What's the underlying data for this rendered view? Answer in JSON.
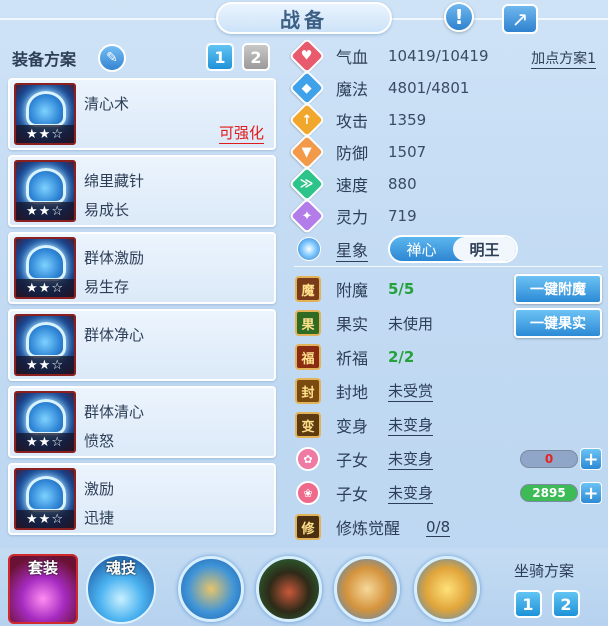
{
  "title": "战备",
  "header": {
    "info_icon": "!",
    "share_icon": "↗"
  },
  "equip_scheme": {
    "label": "装备方案",
    "buttons": [
      "1",
      "2"
    ],
    "active": "1"
  },
  "equipment": [
    {
      "name": "清心术",
      "sub": "",
      "action": "可强化",
      "stars": "★★☆"
    },
    {
      "name": "绵里藏针",
      "sub": "易成长",
      "action": "",
      "stars": "★★☆"
    },
    {
      "name": "群体激励",
      "sub": "易生存",
      "action": "",
      "stars": "★★☆"
    },
    {
      "name": "群体净心",
      "sub": "",
      "action": "",
      "stars": "★★☆"
    },
    {
      "name": "群体清心",
      "sub": "愤怒",
      "action": "",
      "stars": "★★☆"
    },
    {
      "name": "激励",
      "sub": "迅捷",
      "action": "",
      "stars": "★★☆"
    }
  ],
  "stats": [
    {
      "label": "气血",
      "value": "10419/10419",
      "color": "#e85a6e",
      "icon": "heart-icon",
      "glyph": "♥"
    },
    {
      "label": "魔法",
      "value": "4801/4801",
      "color": "#3fa1ea",
      "icon": "mana-icon",
      "glyph": "◆"
    },
    {
      "label": "攻击",
      "value": "1359",
      "color": "#f1a72c",
      "icon": "sword-icon",
      "glyph": "↑"
    },
    {
      "label": "防御",
      "value": "1507",
      "color": "#f39a4a",
      "icon": "shield-icon",
      "glyph": "▼"
    },
    {
      "label": "速度",
      "value": "880",
      "color": "#2cc48a",
      "icon": "speed-icon",
      "glyph": "≫"
    },
    {
      "label": "灵力",
      "value": "719",
      "color": "#b27de8",
      "icon": "spirit-icon",
      "glyph": "✦"
    }
  ],
  "add_point_label": "加点方案1",
  "xingxiang": {
    "label": "星象",
    "options": [
      "禅心",
      "明王"
    ],
    "selected": "明王"
  },
  "buffs": [
    {
      "label": "附魔",
      "value": "5/5",
      "style": "green",
      "icon": "enchant-icon",
      "glyph": "魔",
      "bg": "#7a3b1a"
    },
    {
      "label": "果实",
      "value": "未使用",
      "style": "plain",
      "icon": "fruit-icon",
      "glyph": "果",
      "bg": "#2f6b22"
    },
    {
      "label": "祈福",
      "value": "2/2",
      "style": "green",
      "icon": "blessing-icon",
      "glyph": "福",
      "bg": "#8a2c12"
    },
    {
      "label": "封地",
      "value": "未受赏",
      "style": "link",
      "icon": "fief-icon",
      "glyph": "封",
      "bg": "#7a4a10"
    },
    {
      "label": "变身",
      "value": "未变身",
      "style": "link",
      "icon": "transform-icon",
      "glyph": "变",
      "bg": "#5e3a10"
    }
  ],
  "action_buttons": {
    "enchant": "一键附魔",
    "fruit": "一键果实"
  },
  "children": [
    {
      "label": "子女",
      "value": "未变身",
      "bar_value": "0",
      "bar_color": "#8fa6c8",
      "bar_text_color": "#e8231f",
      "icon_color": "#ef7aa4"
    },
    {
      "label": "子女",
      "value": "未变身",
      "bar_value": "2895",
      "bar_color": "#3dbb56",
      "bar_text_color": "#ffffff",
      "icon_color": "#ef6a8a"
    }
  ],
  "cultivation": {
    "label": "修炼觉醒",
    "value": "0/8"
  },
  "bottom": {
    "suit_label": "套装",
    "soul_label": "魂技",
    "mount_label": "坐骑方案",
    "mount_buttons": [
      "1",
      "2"
    ]
  }
}
